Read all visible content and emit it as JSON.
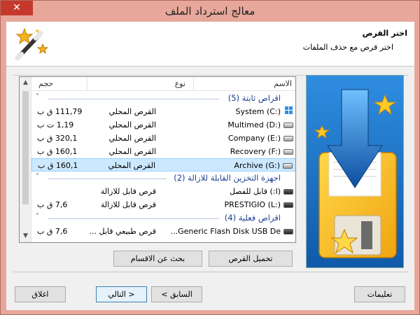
{
  "window": {
    "title": "معالج استرداد الملف",
    "close_glyph": "✕"
  },
  "header": {
    "title": "اختر القرص",
    "subtitle": "اختر قرص مع حذف الملفات",
    "icon": "magic-wand-icon"
  },
  "columns": {
    "name": "الاسم",
    "type": "نوع",
    "size": "حجم"
  },
  "groups": [
    {
      "label": "اقراص ثابتة (5)",
      "rows": [
        {
          "name": "System (C:)",
          "type": "القرص المحلي",
          "size": "111,79 ق ب",
          "icon": "windows-drive-icon"
        },
        {
          "name": "Multimed (D:)",
          "type": "القرص المحلي",
          "size": "1,19 ت ب",
          "icon": "drive-icon"
        },
        {
          "name": "Company (E:)",
          "type": "القرص المحلي",
          "size": "320,1 ق ب",
          "icon": "drive-icon"
        },
        {
          "name": "Recovery (F:)",
          "type": "القرص المحلي",
          "size": "160,1 ق ب",
          "icon": "drive-icon"
        },
        {
          "name": "Archive (G:)",
          "type": "القرص المحلي",
          "size": "160,1 ق ب",
          "icon": "drive-icon",
          "selected": true
        }
      ]
    },
    {
      "label": "اجهزة التخزين القابلة للازالة (2)",
      "rows": [
        {
          "name": "(I:) قابل للفصل",
          "type": "قرص قابل للازالة",
          "size": "",
          "icon": "removable-drive-icon"
        },
        {
          "name": "PRESTIGIO (L:)",
          "type": "قرص قابل للازالة",
          "size": "7,6 ق ب",
          "icon": "removable-drive-icon"
        }
      ]
    },
    {
      "label": "اقراص فعلية (4)",
      "rows": [
        {
          "name": "Generic Flash Disk USB De...",
          "type": "قرص طبيعي قابل ...",
          "size": "7,6 ق ب",
          "icon": "physical-drive-icon"
        }
      ]
    }
  ],
  "actions": {
    "load_disk": "تحميل القرص",
    "find_partitions": "بحث عن الاقسام"
  },
  "footer": {
    "help": "تعليمات",
    "back": "< السابق",
    "next": "التالي >",
    "close": "اغلاق"
  },
  "colors": {
    "title_bar": "#e7a79a",
    "group_text": "#1e3f8f",
    "selection": "#cce8ff",
    "art_bg": "#1a74c4"
  }
}
